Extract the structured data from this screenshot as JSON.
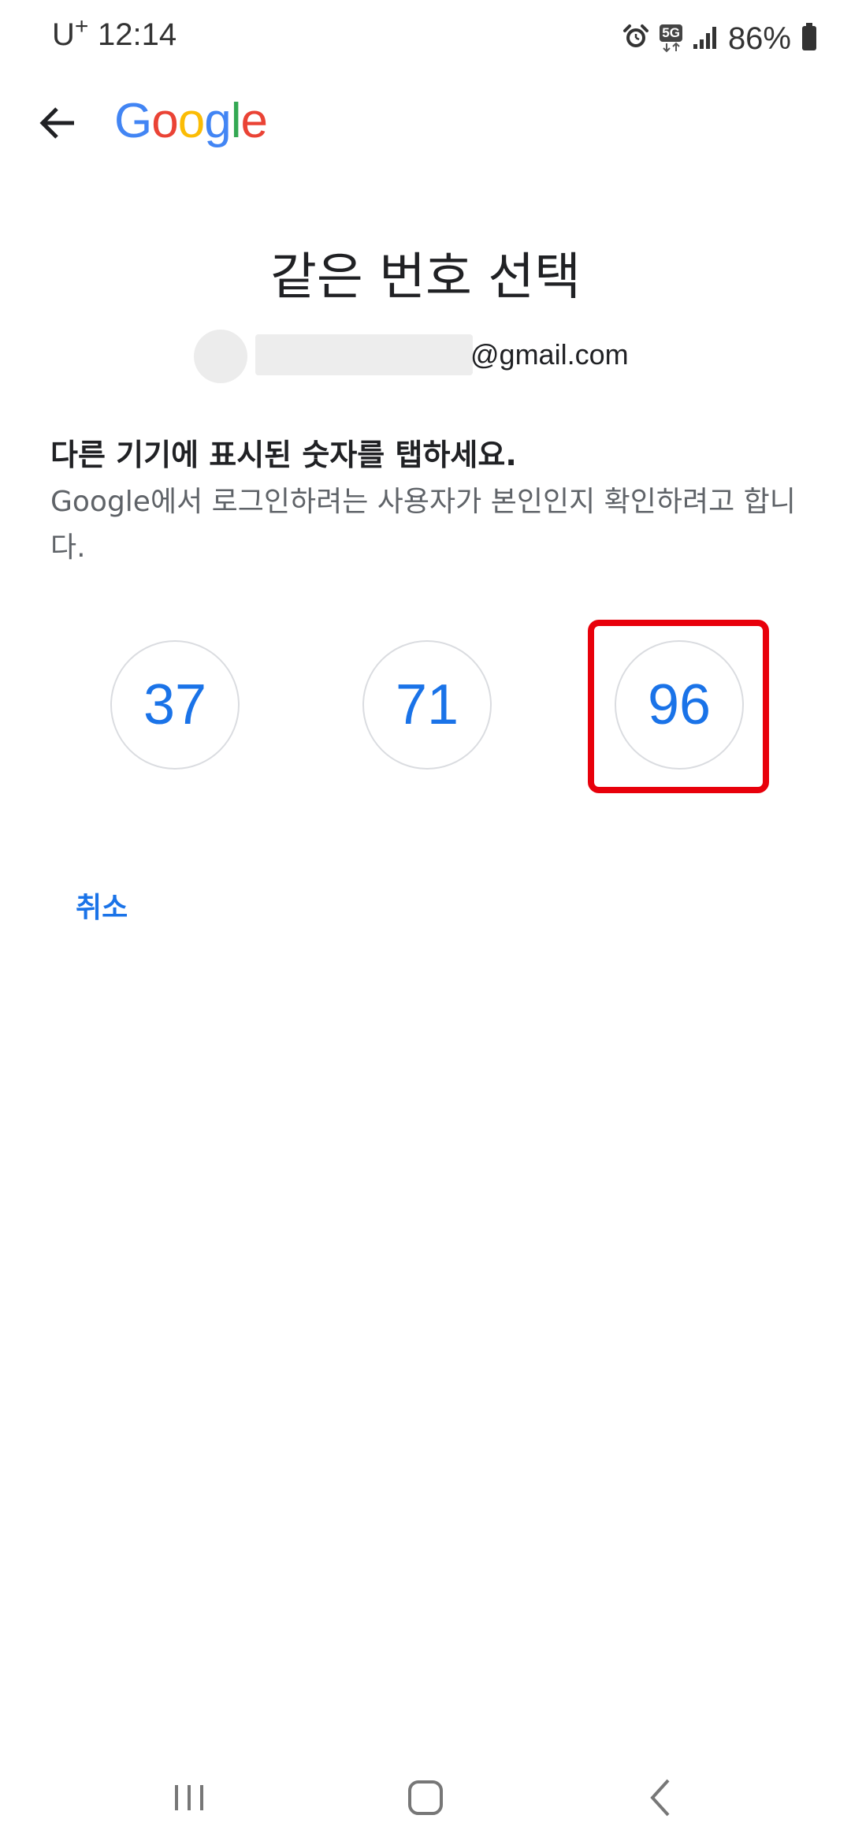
{
  "status_bar": {
    "carrier": "U",
    "carrier_plus": "+",
    "time": "12:14",
    "network": "5G",
    "battery": "86%"
  },
  "header": {
    "logo_letters": [
      "G",
      "o",
      "o",
      "g",
      "l",
      "e"
    ]
  },
  "page": {
    "title": "같은 번호 선택",
    "account_email_suffix": "@gmail.com",
    "instruction_heading": "다른 기기에 표시된 숫자를 탭하세요.",
    "instruction_body": "Google에서 로그인하려는 사용자가 본인인지 확인하려고 합니다."
  },
  "choices": [
    {
      "label": "37"
    },
    {
      "label": "71"
    },
    {
      "label": "96"
    }
  ],
  "actions": {
    "cancel_label": "취소"
  },
  "colors": {
    "accent": "#1a73e8",
    "highlight": "#e8000b",
    "google_blue": "#4285F4",
    "google_red": "#EA4335",
    "google_yellow": "#FBBC05",
    "google_green": "#34A853"
  },
  "icons": {
    "back": "arrow-left-icon",
    "alarm": "alarm-icon",
    "signal": "signal-icon",
    "battery": "battery-icon",
    "nav_recents": "recents-icon",
    "nav_home": "home-icon",
    "nav_back": "chevron-left-icon"
  }
}
